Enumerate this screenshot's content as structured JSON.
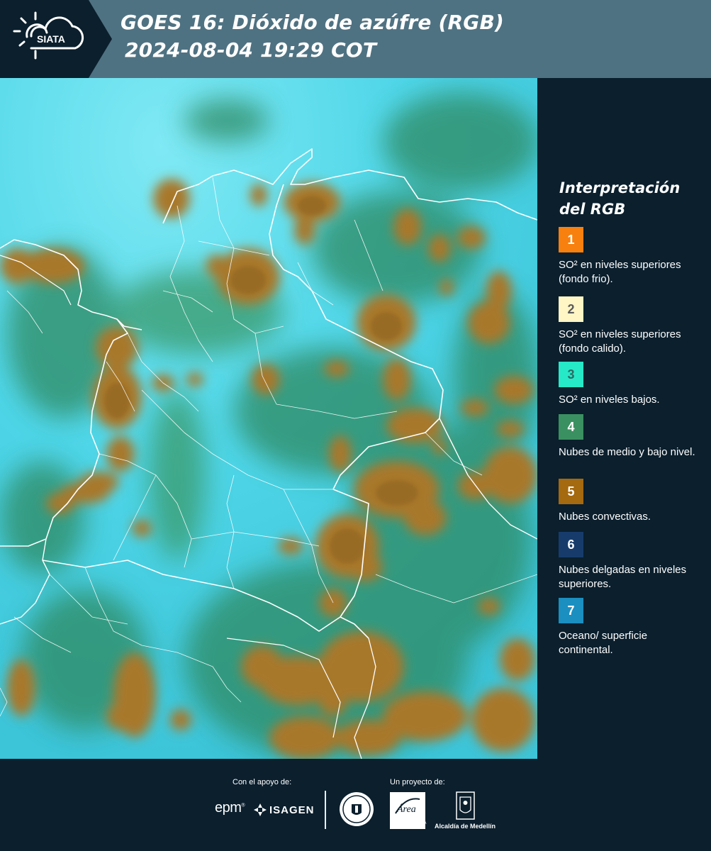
{
  "header": {
    "logo_text": "SIATA",
    "title_line1": "GOES 16: Dióxido de azúfre (RGB)",
    "title_line2": "2024-08-04 19:29 COT"
  },
  "legend": {
    "title": "Interpretación del RGB",
    "items": [
      {
        "number": "1",
        "color": "#f7800e",
        "text_color": "#ffffff",
        "label": "SO² en niveles superiores (fondo frio)."
      },
      {
        "number": "2",
        "color": "#fff5c5",
        "text_color": "#5a5a5a",
        "label": "SO² en niveles superiores (fondo calido)."
      },
      {
        "number": "3",
        "color": "#26e9c8",
        "text_color": "#2b6b63",
        "label": "SO² en niveles bajos."
      },
      {
        "number": "4",
        "color": "#3a9060",
        "text_color": "#ffffff",
        "label": "Nubes de medio y bajo nivel."
      },
      {
        "number": "5",
        "color": "#a5690f",
        "text_color": "#ffffff",
        "label": "Nubes convectivas."
      },
      {
        "number": "6",
        "color": "#173c6c",
        "text_color": "#ffffff",
        "label": "Nubes delgadas en niveles superiores."
      },
      {
        "number": "7",
        "color": "#1a8fc0",
        "text_color": "#ffffff",
        "label": "Oceano/ superficie continental."
      }
    ]
  },
  "footer": {
    "support_label": "Con el apoyo de:",
    "project_label": "Un proyecto de:",
    "epm_logo_text": "epm",
    "isagen_logo_text": "ISAGEN",
    "area_logo_text": "Área",
    "area_subtext": "METROPOLITANA Valle de Aburrá",
    "alcaldia_logo_text": "Alcaldía de Medellín"
  },
  "colors": {
    "background_dark": "#0b1f2d",
    "header_bar": "#4f7282",
    "map_base_cyan": "#4fd6e8",
    "cloud_brown": "#a8782a",
    "cloud_green": "#2e8a62",
    "border_white": "#ffffff"
  }
}
